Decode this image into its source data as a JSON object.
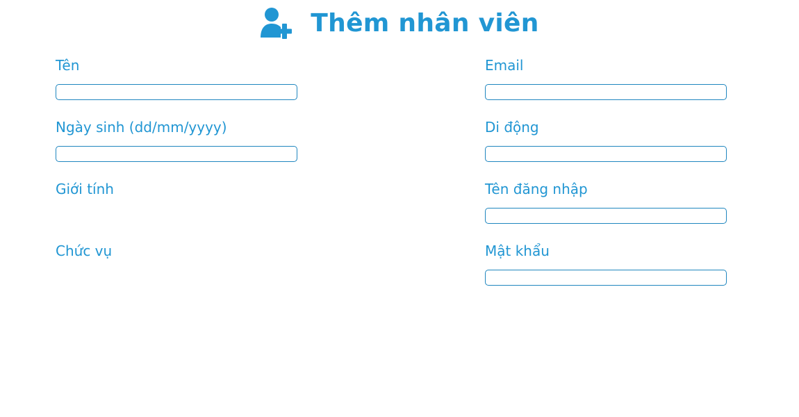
{
  "header": {
    "title": "Thêm nhân viên",
    "icon": "user-plus-icon",
    "color": "#2196d3"
  },
  "form": {
    "left": {
      "name_label": "Tên",
      "name_value": "",
      "birthdate_label": "Ngày sinh (dd/mm/yyyy)",
      "birthdate_value": "",
      "gender_label": "Giới tính",
      "position_label": "Chức vụ"
    },
    "right": {
      "email_label": "Email",
      "email_value": "",
      "mobile_label": "Di động",
      "mobile_value": "",
      "username_label": "Tên đăng nhập",
      "username_value": "",
      "password_label": "Mật khẩu",
      "password_value": ""
    }
  }
}
